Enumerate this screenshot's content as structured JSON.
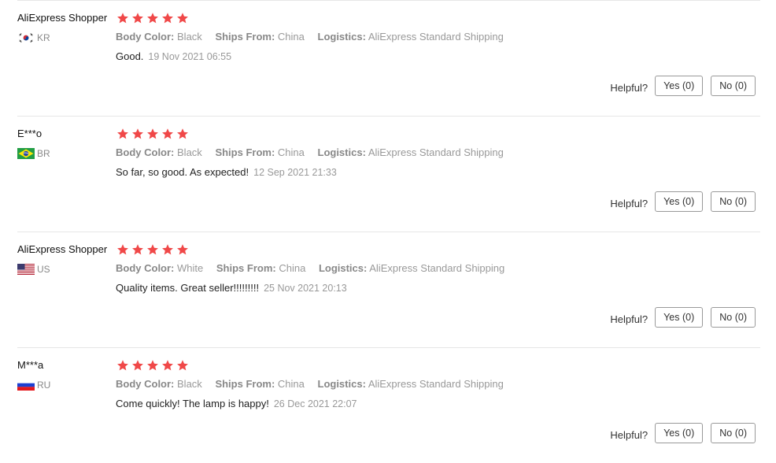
{
  "colors": {
    "star": "#f04848",
    "muted": "#999999",
    "divider": "#e6e6e6"
  },
  "helpful_label": "Helpful?",
  "attr_labels": {
    "body_color": "Body Color:",
    "ships_from": "Ships From:",
    "logistics": "Logistics:"
  },
  "reviews": [
    {
      "user": "AliExpress Shopper",
      "country": "KR",
      "flag": "kr-flag-icon",
      "rating": 5,
      "body_color": "Black",
      "ships_from": "China",
      "logistics": "AliExpress Standard Shipping",
      "text": "Good.",
      "date": "19 Nov 2021 06:55",
      "yes": "Yes (0)",
      "no": "No (0)"
    },
    {
      "user": "E***o",
      "country": "BR",
      "flag": "br-flag-icon",
      "rating": 5,
      "body_color": "Black",
      "ships_from": "China",
      "logistics": "AliExpress Standard Shipping",
      "text": "So far, so good. As expected!",
      "date": "12 Sep 2021 21:33",
      "yes": "Yes (0)",
      "no": "No (0)"
    },
    {
      "user": "AliExpress Shopper",
      "country": "US",
      "flag": "us-flag-icon",
      "rating": 5,
      "body_color": "White",
      "ships_from": "China",
      "logistics": "AliExpress Standard Shipping",
      "text": "Quality items. Great seller!!!!!!!!!",
      "date": "25 Nov 2021 20:13",
      "yes": "Yes (0)",
      "no": "No (0)"
    },
    {
      "user": "M***a",
      "country": "RU",
      "flag": "ru-flag-icon",
      "rating": 5,
      "body_color": "Black",
      "ships_from": "China",
      "logistics": "AliExpress Standard Shipping",
      "text": "Come quickly! The lamp is happy!",
      "date": "26 Dec 2021 22:07",
      "yes": "Yes (0)",
      "no": "No (0)"
    }
  ]
}
